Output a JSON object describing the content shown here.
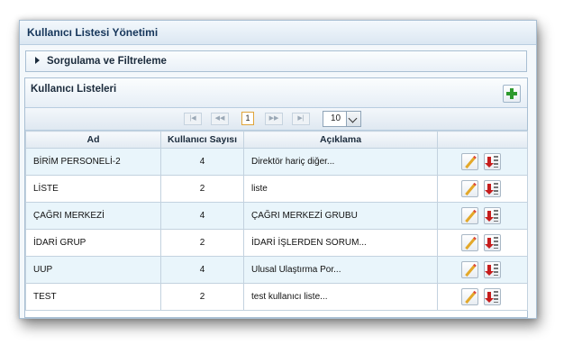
{
  "window": {
    "title": "Kullanıcı Listesi Yönetimi"
  },
  "filter": {
    "label": "Sorgulama ve Filtreleme"
  },
  "panel": {
    "title": "Kullanıcı Listeleri"
  },
  "pager": {
    "current_page": "1",
    "page_size": "10"
  },
  "table": {
    "columns": [
      "Ad",
      "Kullanıcı Sayısı",
      "Açıklama",
      ""
    ],
    "rows": [
      {
        "name": "BİRİM PERSONELİ-2",
        "count": "4",
        "desc": "Direktör hariç diğer..."
      },
      {
        "name": "LİSTE",
        "count": "2",
        "desc": "liste"
      },
      {
        "name": "ÇAĞRI MERKEZİ",
        "count": "4",
        "desc": "ÇAĞRI MERKEZİ GRUBU"
      },
      {
        "name": "İDARİ GRUP",
        "count": "2",
        "desc": "İDARİ İŞLERDEN SORUM..."
      },
      {
        "name": "UUP",
        "count": "4",
        "desc": "Ulusal Ulaştırma Por..."
      },
      {
        "name": "TEST",
        "count": "2",
        "desc": "test kullanıcı liste..."
      }
    ]
  },
  "icons": {
    "add": "plus-icon",
    "edit": "pencil-icon",
    "delete": "delete-icon",
    "expand": "caret-right-icon"
  },
  "colors": {
    "accent_green": "#2e9a2e",
    "row_alt": "#e9f5fb",
    "title_text": "#15355a"
  }
}
